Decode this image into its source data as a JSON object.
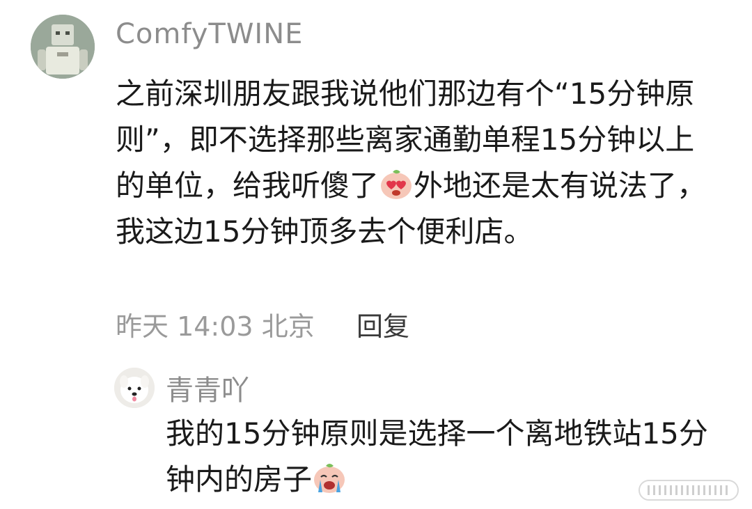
{
  "comment": {
    "username": "ComfyTWINE",
    "text_part1": "之前深圳朋友跟我说他们那边有个“15分钟原则”，即不选择那些离家通勤单程15分钟以上的单位，给我听傻了",
    "text_emoji1": "heart-eyes-emoji",
    "text_part2": "外地还是太有说法了，我这边15分钟顶多去个便利店。",
    "timestamp": "昨天 14:03",
    "location": "北京",
    "reply_label": "回复"
  },
  "reply": {
    "username": "青青吖",
    "text_part1": "我的15分钟原则是选择一个离地铁站15分钟内的房子",
    "text_emoji1": "crying-emoji"
  },
  "colors": {
    "username": "#8c8c8c",
    "body_text": "#1a1a1a",
    "meta_text": "#9a9a9a",
    "reply_action": "#3a3a3a",
    "background": "#ffffff"
  }
}
